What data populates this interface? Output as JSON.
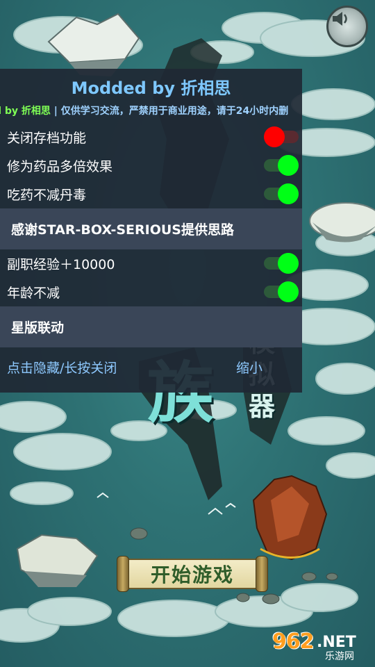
{
  "menu": {
    "title": "Modded by 折相思",
    "marquee_prefix": "d by 折相思",
    "marquee_text": " | 仅供学习交流，严禁用于商业用途，请于24小时内删",
    "toggles": [
      {
        "label": "关闭存档功能",
        "state": "off"
      },
      {
        "label": "修为药品多倍效果",
        "state": "on"
      },
      {
        "label": "吃药不减丹毒",
        "state": "on"
      }
    ],
    "section1": "感谢STAR-BOX-SERIOUS提供思路",
    "toggles2": [
      {
        "label": "副职经验＋10000",
        "state": "on"
      },
      {
        "label": "年龄不减",
        "state": "on"
      }
    ],
    "section2": "星版联动",
    "footer_left": "点击隐藏/长按关闭",
    "footer_right": "缩小"
  },
  "game": {
    "title_char": "族",
    "title_side": "模拟器",
    "start_label": "开始游戏"
  },
  "watermark": {
    "number": "962",
    "domain": ".NET",
    "site_name": "乐游网"
  }
}
